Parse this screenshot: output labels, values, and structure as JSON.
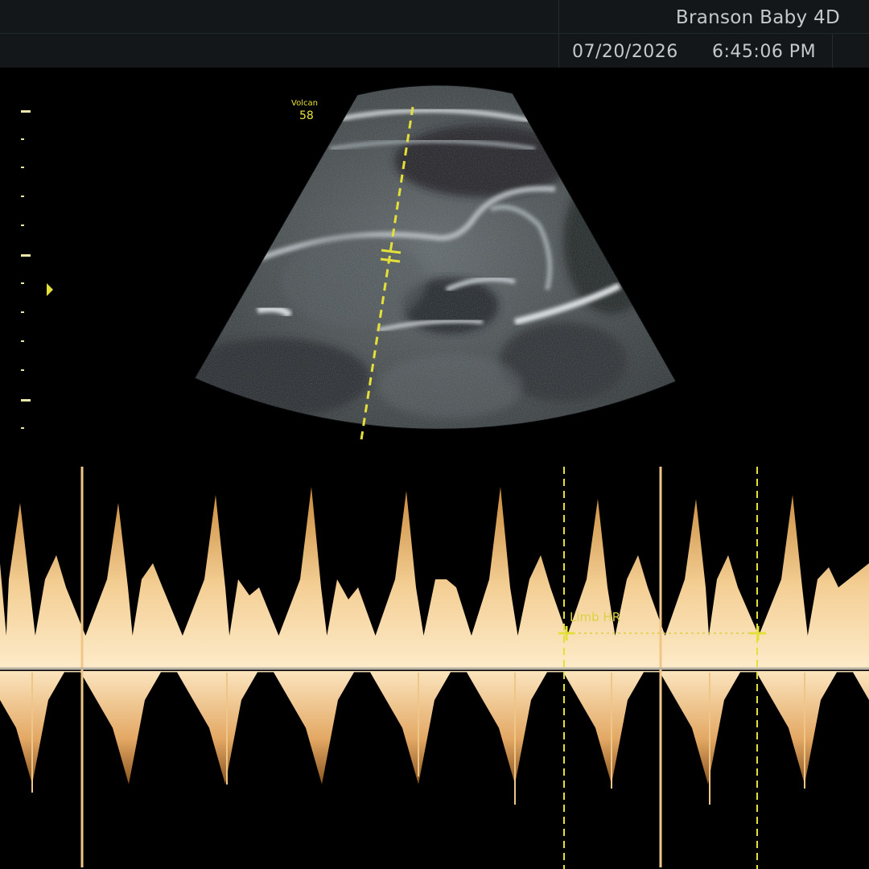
{
  "header": {
    "title": "Branson Baby 4D",
    "date": "07/20/2026",
    "time": "6:45:06 PM"
  },
  "sample_volume": {
    "label": "Volcan",
    "value": "58"
  },
  "doppler": {
    "measurement_label": "Limb HR"
  },
  "icons": {
    "focus_marker": "triangle-marker-icon",
    "caliper": "caliper-cross-icon"
  },
  "colors": {
    "annotation_yellow": "#e5df3a",
    "doppler_fill": "#f2c98e",
    "baseline": "#b7b1a3"
  }
}
